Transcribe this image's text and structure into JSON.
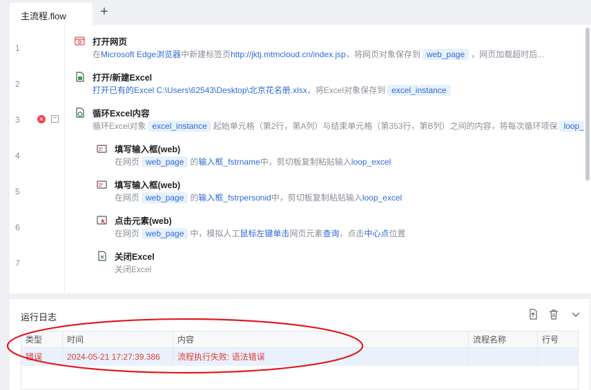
{
  "tabs": [
    {
      "label": "主流程.flow"
    }
  ],
  "tab_add_icon": "plus-icon",
  "editor": {
    "line_numbers": [
      "1",
      "2",
      "3",
      "4",
      "5",
      "6",
      "7"
    ],
    "error_line": "3",
    "steps": [
      {
        "icon": "browser-icon",
        "title": "打开网页",
        "desc": {
          "p1": "在",
          "browser": "Microsoft Edge浏览器",
          "p2": "中新建标签页",
          "url": "http://jktj.mtmcloud.cn/index.jsp",
          "p3": "，将网页对象保存到",
          "var": "web_page",
          "p4": "，网页加载超时后..."
        }
      },
      {
        "icon": "excel-open-icon",
        "title": "打开/新建Excel",
        "desc": {
          "p1": "打开已有的Excel C:\\Users\\62543\\Desktop\\北京花名册.xlsx",
          "p2": "，将Excel对象保存到",
          "var": "excel_instance"
        }
      },
      {
        "icon": "excel-loop-icon",
        "title": "循环Excel内容",
        "desc": {
          "p1": "循环Excel对象",
          "var": "excel_instance",
          "p2": "起始单元格（第2行，第A列）与结束单元格（第353行，第B列）之间的内容，将每次循环项保",
          "var2": "loop_i"
        }
      },
      {
        "icon": "input-fill-icon",
        "title": "填写输入框(web)",
        "desc": {
          "p1": "在网页",
          "var": "web_page",
          "p2": "的",
          "link": "输入框_fstrname",
          "p3": "中，剪切板复制粘贴输入",
          "link2": "loop_excel"
        }
      },
      {
        "icon": "input-fill-icon",
        "title": "填写输入框(web)",
        "desc": {
          "p1": "在网页",
          "var": "web_page",
          "p2": "的",
          "link": "输入框_fstrpersonid",
          "p3": "中，剪切板复制粘贴输入",
          "link2": "loop_excel"
        }
      },
      {
        "icon": "click-element-icon",
        "title": "点击元素(web)",
        "desc": {
          "p1": "在网页",
          "var": "web_page",
          "p2": "中，模拟人工",
          "link": "鼠标左键单击",
          "p3": "网页元素",
          "link2": "查询",
          "p4": "，点击",
          "link3": "中心点",
          "p5": "位置"
        }
      },
      {
        "icon": "excel-close-icon",
        "title": "关闭Excel",
        "desc": {
          "p1": "关闭Excel"
        }
      }
    ]
  },
  "log": {
    "title": "运行日志",
    "tools": [
      "export-icon",
      "trash-icon",
      "chevron-down-icon"
    ],
    "columns": [
      "类型",
      "时间",
      "内容",
      "流程名称",
      "行号"
    ],
    "rows": [
      {
        "type": "错误",
        "time": "2024-05-21 17:27:39.386",
        "content": "流程执行失败: 语法错误",
        "flow": "",
        "line": ""
      }
    ]
  },
  "colors": {
    "accent": "#2f6ad8",
    "error": "#e23b3b",
    "annotation": "#e0191d"
  }
}
